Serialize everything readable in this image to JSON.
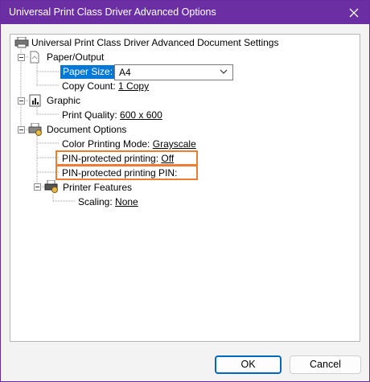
{
  "window": {
    "title": "Universal Print Class Driver Advanced Options"
  },
  "tree": {
    "root": "Universal Print Class Driver Advanced Document Settings",
    "paper_output": {
      "label": "Paper/Output",
      "paper_size_label": "Paper Size:",
      "paper_size_value": "A4",
      "copy_count_label": "Copy Count:",
      "copy_count_value": "1 Copy"
    },
    "graphic": {
      "label": "Graphic",
      "print_quality_label": "Print Quality:",
      "print_quality_value": "600 x 600"
    },
    "document_options": {
      "label": "Document Options",
      "color_mode_label": "Color Printing Mode:",
      "color_mode_value": "Grayscale",
      "pin_printing_label": "PIN-protected printing:",
      "pin_printing_value": "Off",
      "pin_label": "PIN-protected printing PIN:",
      "printer_features": {
        "label": "Printer Features",
        "scaling_label": "Scaling:",
        "scaling_value": "None"
      }
    }
  },
  "buttons": {
    "ok": "OK",
    "cancel": "Cancel"
  },
  "colors": {
    "titlebar": "#6b2fa3",
    "selection": "#0078d7",
    "highlight": "#ed7d31",
    "ok_border": "#0067c0"
  },
  "icons": [
    "close-icon",
    "printer-icon",
    "paper-icon",
    "graphic-icon",
    "document-options-icon",
    "printer-features-icon",
    "collapse-icon",
    "chevron-down-icon"
  ]
}
